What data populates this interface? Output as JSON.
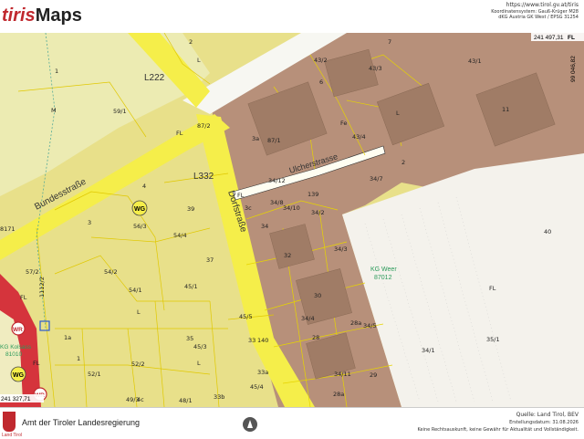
{
  "header": {
    "logo_part1": "tiris",
    "logo_part2": "Maps",
    "url": "https://www.tirol.gv.at/tiris",
    "coord_system": "Koordinatensystem: Gauß-Krüger M28",
    "coord_detail": "dKG Austria GK West / EPSG 31254"
  },
  "map": {
    "coord_top_right": "241 497,31",
    "coord_right_vertical": "99 046,82",
    "coord_bottom_left": "241 327,71",
    "fl_top_right": "FL",
    "roads": {
      "l222": "L222",
      "l332": "L332",
      "bundesstrasse": "Bundesstraße",
      "dorfstrasse": "Dorfstraße",
      "uelcherstrasse": "Ulcherstrasse"
    },
    "zones": {
      "wg1": "WG",
      "wg2": "WG",
      "wr1": "WR",
      "wr2": "WR"
    },
    "kg_weer": "KG Weer",
    "kg_weer_num": "87012",
    "kg_kolsass": "KG Kolsass",
    "kg_kolsass_num": "81010",
    "parcels": {
      "p2": "2",
      "pL1": "L",
      "p1": "1",
      "pM": "M",
      "p59_1": "59/1",
      "p43_2": "43/2",
      "p6": "6",
      "p7": "7",
      "p43_3": "43/3",
      "p43_1": "43/1",
      "p87_2": "87/2",
      "pFL1": "FL",
      "p3a": "3a",
      "p87_1": "87/1",
      "p5": "Fe",
      "p43_4": "43/4",
      "pL2": "L",
      "p11": "11",
      "p2b": "2",
      "p34_7": "34/7",
      "p4": "4",
      "p39": "39",
      "p3": "3",
      "p56_3": "56/3",
      "p54_4": "54/4",
      "p37": "37",
      "p54_2": "54/2",
      "p57_2": "57/2",
      "p54_1": "54/1",
      "p45_1": "45/1",
      "p1112_2": "1112/2",
      "pL3": "L",
      "p45_5": "45/5",
      "p35": "35",
      "p45_3": "45/3",
      "p33": "33",
      "p140": "140",
      "p1a": "1a",
      "p1b": "1",
      "p52_1": "52/1",
      "p52_2": "52/2",
      "p33a": "33a",
      "p45_4": "45/4",
      "p33b": "33b",
      "p49_3": "49/3",
      "p48_1": "48/1",
      "p4c": "4c",
      "pFL2": "FL",
      "p34_12": "34/12",
      "p139": "139",
      "p34_8": "34/8",
      "p34_10": "34/10",
      "p34_2": "34/2",
      "p34": "34",
      "p3c": "3c",
      "p32": "32",
      "p34_3": "34/3",
      "p30": "30",
      "p34_4": "34/4",
      "p28a": "28a",
      "p34_5": "34/5",
      "p28": "28",
      "p34_11": "34/11",
      "p29": "29",
      "p28b": "28a",
      "p40": "40",
      "pFL3": "FL",
      "p34_1": "34/1",
      "p35_1": "35/1",
      "p8171": "8171",
      "pFL4": "FL",
      "pFL5": "FL",
      "pL4": "L"
    }
  },
  "footer": {
    "crest_label": "Land Tirol",
    "org": "Amt der Tiroler Landesregierung",
    "source": "Quelle: Land Tirol, BEV",
    "date": "Erstellungsdatum: 31.08.2026",
    "disclaimer": "Keine Rechtsauskunft, keine Gewähr für Aktualität und Vollständigkeit."
  },
  "colors": {
    "settlement_yellow": "#e8e08a",
    "built_brown": "#b7907a",
    "road_yellow": "#f5ee4a",
    "field_white": "#f7f5f0",
    "parcel_line": "#e0c800",
    "red_zone": "#d5343c"
  }
}
